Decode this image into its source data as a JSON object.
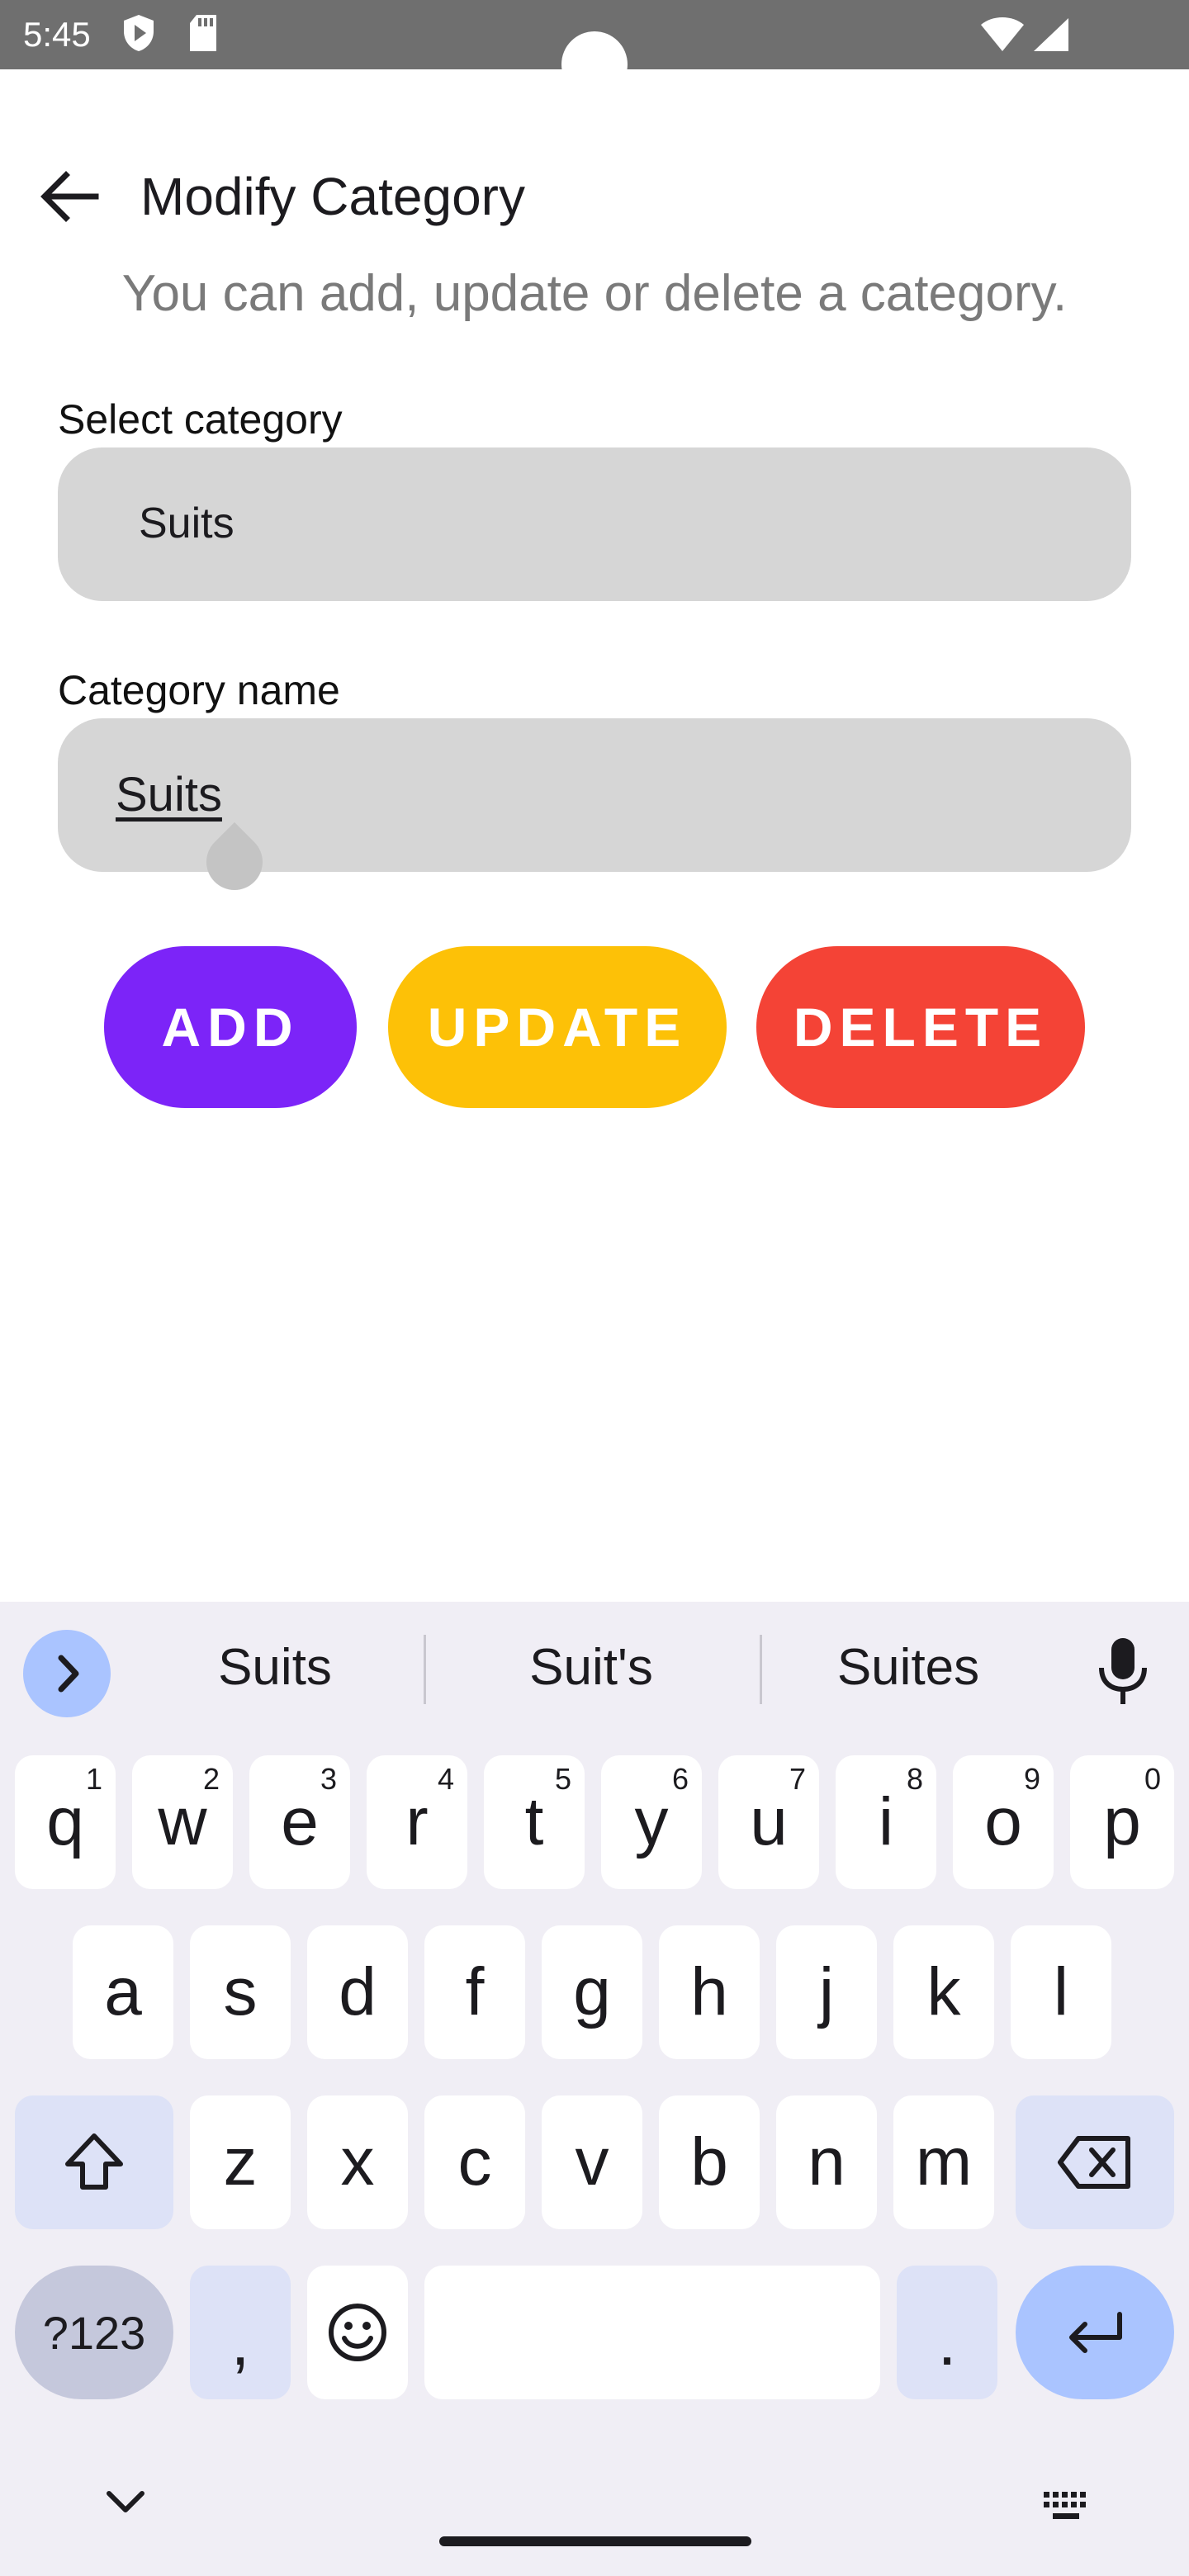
{
  "status_bar": {
    "time": "5:45"
  },
  "header": {
    "title": "Modify Category",
    "back_icon": "arrow-back-icon"
  },
  "subtitle": "You can add, update or delete a category.",
  "select_field": {
    "label": "Select category",
    "value": "Suits"
  },
  "name_field": {
    "label": "Category name",
    "value": "Suits"
  },
  "buttons": {
    "add": "ADD",
    "update": "UPDATE",
    "delete": "DELETE",
    "colors": {
      "add": "#7c24f8",
      "update": "#fdc107",
      "delete": "#f44336"
    }
  },
  "keyboard": {
    "suggestions": [
      "Suits",
      "Suit's",
      "Suites"
    ],
    "row1": [
      {
        "k": "q",
        "h": "1"
      },
      {
        "k": "w",
        "h": "2"
      },
      {
        "k": "e",
        "h": "3"
      },
      {
        "k": "r",
        "h": "4"
      },
      {
        "k": "t",
        "h": "5"
      },
      {
        "k": "y",
        "h": "6"
      },
      {
        "k": "u",
        "h": "7"
      },
      {
        "k": "i",
        "h": "8"
      },
      {
        "k": "o",
        "h": "9"
      },
      {
        "k": "p",
        "h": "0"
      }
    ],
    "row2": [
      "a",
      "s",
      "d",
      "f",
      "g",
      "h",
      "j",
      "k",
      "l"
    ],
    "row3": [
      "z",
      "x",
      "c",
      "v",
      "b",
      "n",
      "m"
    ],
    "symbols_label": "?123",
    "comma": ",",
    "period": "."
  }
}
